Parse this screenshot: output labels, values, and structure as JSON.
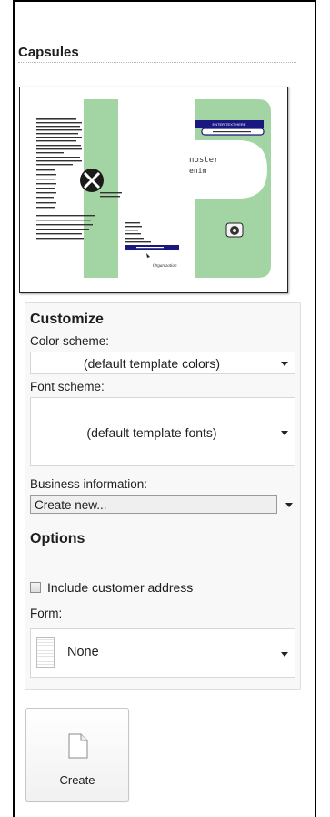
{
  "template_title": "Capsules",
  "preview": {
    "header_text": "ENTER TEXT HERE",
    "title_line1": "noster",
    "title_line2": "enim",
    "organization": "Organization"
  },
  "customize": {
    "heading": "Customize",
    "color_scheme": {
      "label": "Color scheme:",
      "value": "(default template colors)"
    },
    "font_scheme": {
      "label": "Font scheme:",
      "value": "(default template fonts)"
    },
    "business_info": {
      "label": "Business information:",
      "value": "Create new..."
    }
  },
  "options": {
    "heading": "Options",
    "include_address": {
      "label": "Include customer address",
      "checked": false
    },
    "form": {
      "label": "Form:",
      "value": "None"
    }
  },
  "create_button": {
    "label": "Create"
  },
  "colors": {
    "brochure_green": "#a3d4a3",
    "brochure_blue": "#1a1780"
  }
}
